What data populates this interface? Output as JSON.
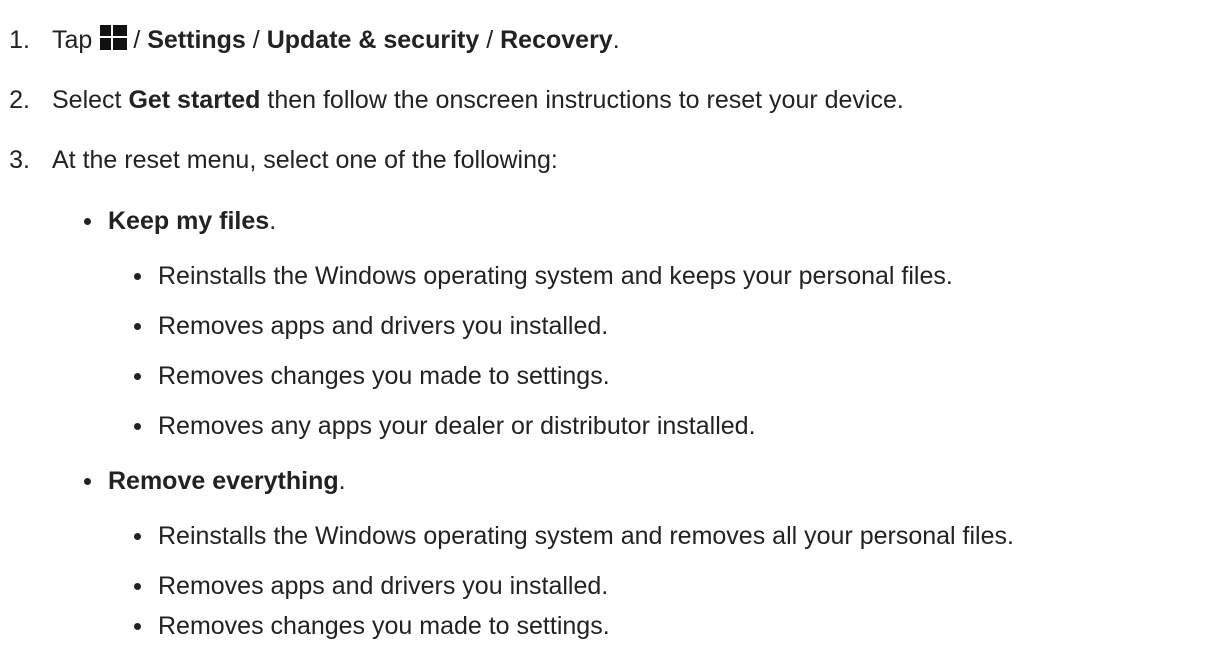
{
  "steps": [
    {
      "number": "1.",
      "prefix": "Tap",
      "icon": "windows-logo-icon",
      "sep1": "/",
      "settings": "Settings",
      "sep2": "/",
      "update_security": "Update & security",
      "sep3": "/",
      "recovery": "Recovery",
      "suffix": "."
    },
    {
      "number": "2.",
      "prefix": "Select",
      "get_started": "Get started",
      "suffix": "then follow the onscreen instructions to reset your device."
    },
    {
      "number": "3.",
      "text": "At the reset menu, select one of the following:"
    }
  ],
  "options": [
    {
      "title": "Keep my files",
      "period": ".",
      "items": [
        "Reinstalls the Windows operating system and keeps your personal files.",
        "Removes apps and drivers you installed.",
        "Removes changes you made to settings.",
        "Removes any apps your dealer or distributor installed."
      ]
    },
    {
      "title": "Remove everything",
      "period": ".",
      "items": [
        "Reinstalls the Windows operating system and removes all your personal files.",
        "Removes apps and drivers you installed.",
        "Removes changes you made to settings."
      ]
    }
  ]
}
